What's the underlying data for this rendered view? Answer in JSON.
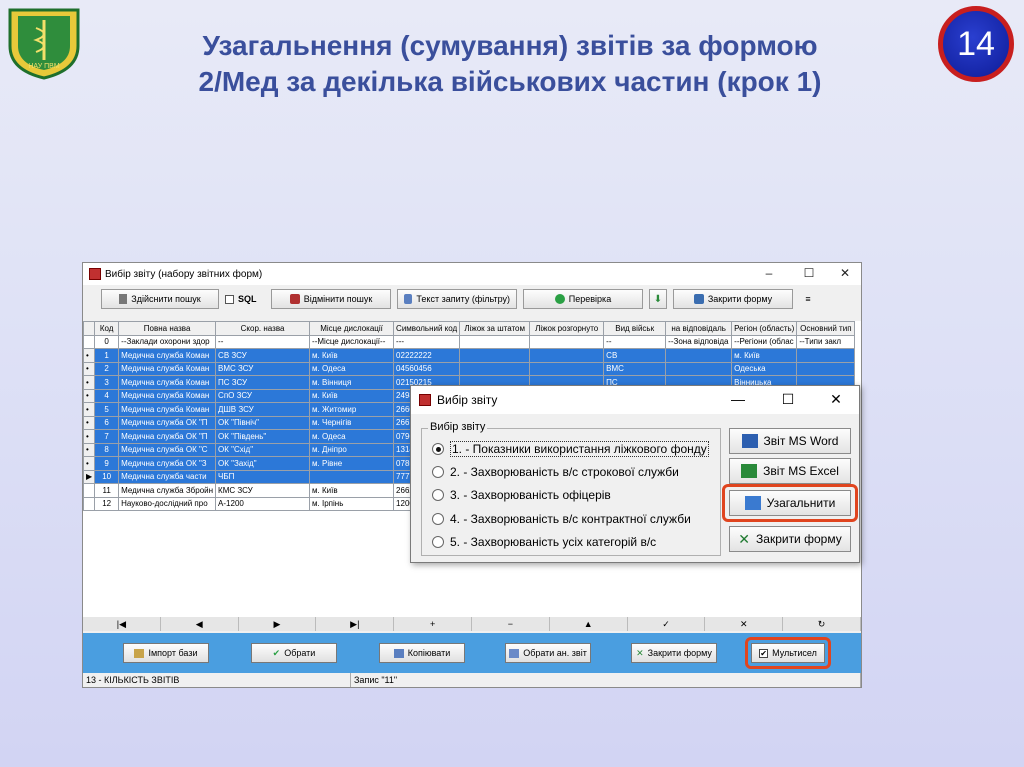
{
  "slide": {
    "title_line1": "Узагальнення (сумування) звітів за формою",
    "title_line2": "2/Мед за декілька військових частин (крок 1)",
    "number": "14",
    "emblem_text": "НАУ ПВМ"
  },
  "main_window": {
    "title": "Вибір звіту (набору звітних форм)",
    "controls": {
      "minimize": "–",
      "maximize": "☐",
      "close": "✕"
    },
    "toolbar": {
      "search": "Здійснити пошук",
      "sql": "SQL",
      "cancel_search": "Відмінити пошук",
      "query_text": "Текст запиту (фільтру)",
      "check": "Перевірка",
      "close_form": "Закрити форму"
    },
    "columns": [
      "",
      "Код",
      "Повна назва",
      "Скор. назва",
      "Місце дислокації",
      "Символьний код",
      "Ліжок за штатом",
      "Ліжок розгорнуто",
      "Вид військ",
      "на відповідаль",
      "Регіон (область)",
      "Основний тип"
    ],
    "rows": [
      {
        "ind": "",
        "code": "0",
        "full": "--Заклади охорони здор",
        "short": "--",
        "place": "--Місце дислокації--",
        "sym": "---",
        "b1": "",
        "b2": "",
        "kind": "--",
        "resp": "--Зона відповіда",
        "region": "--Регіони (облас",
        "type": "--Типи закл",
        "sel": false
      },
      {
        "ind": "•",
        "code": "1",
        "full": "Медична служба Коман",
        "short": "СВ ЗСУ",
        "place": "м. Київ",
        "sym": "02222222",
        "b1": "",
        "b2": "",
        "kind": "СВ",
        "resp": "",
        "region": "м. Київ",
        "type": "",
        "sel": true
      },
      {
        "ind": "•",
        "code": "2",
        "full": "Медична служба Коман",
        "short": "ВМС ЗСУ",
        "place": "м. Одеса",
        "sym": "04560456",
        "b1": "",
        "b2": "",
        "kind": "ВМС",
        "resp": "",
        "region": "Одеська",
        "type": "",
        "sel": true
      },
      {
        "ind": "•",
        "code": "3",
        "full": "Медична служба Коман",
        "short": "ПС ЗСУ",
        "place": "м. Вінниця",
        "sym": "02150215",
        "b1": "",
        "b2": "",
        "kind": "ПС",
        "resp": "",
        "region": "Вінницька",
        "type": "",
        "sel": true
      },
      {
        "ind": "•",
        "code": "4",
        "full": "Медична служба Коман",
        "short": "СпО ЗСУ",
        "place": "м. Київ",
        "sym": "2498",
        "b1": "",
        "b2": "",
        "kind": "",
        "resp": "",
        "region": "",
        "type": "",
        "sel": true
      },
      {
        "ind": "•",
        "code": "5",
        "full": "Медична служба Коман",
        "short": "ДШВ ЗСУ",
        "place": "м. Житомир",
        "sym": "2660",
        "b1": "",
        "b2": "",
        "kind": "",
        "resp": "",
        "region": "",
        "type": "",
        "sel": true
      },
      {
        "ind": "•",
        "code": "6",
        "full": "Медична служба ОК \"П",
        "short": "ОК \"Північ\"",
        "place": "м. Чернігів",
        "sym": "2661",
        "b1": "",
        "b2": "",
        "kind": "",
        "resp": "",
        "region": "",
        "type": "",
        "sel": true
      },
      {
        "ind": "•",
        "code": "7",
        "full": "Медична служба ОК \"П",
        "short": "ОК \"Південь\"",
        "place": "м. Одеса",
        "sym": "0796",
        "b1": "",
        "b2": "",
        "kind": "",
        "resp": "",
        "region": "",
        "type": "",
        "sel": true
      },
      {
        "ind": "•",
        "code": "8",
        "full": "Медична служба ОК \"С",
        "short": "ОК \"Схід\"",
        "place": "м. Дніпро",
        "sym": "1314",
        "b1": "",
        "b2": "",
        "kind": "",
        "resp": "",
        "region": "",
        "type": "",
        "sel": true
      },
      {
        "ind": "•",
        "code": "9",
        "full": "Медична служба ОК \"З",
        "short": "ОК \"Захід\"",
        "place": "м. Рівне",
        "sym": "0785",
        "b1": "",
        "b2": "",
        "kind": "",
        "resp": "",
        "region": "",
        "type": "",
        "sel": true
      },
      {
        "ind": "▶",
        "code": "10",
        "full": "Медична служба части",
        "short": "ЧБП",
        "place": "",
        "sym": "7777",
        "b1": "",
        "b2": "",
        "kind": "",
        "resp": "",
        "region": "",
        "type": "",
        "sel": true
      },
      {
        "ind": "",
        "code": "11",
        "full": "Медична служба Збройн",
        "short": "КМС ЗСУ",
        "place": "м. Київ",
        "sym": "2662",
        "b1": "",
        "b2": "",
        "kind": "",
        "resp": "",
        "region": "",
        "type": "",
        "sel": false
      },
      {
        "ind": "",
        "code": "12",
        "full": "Науково-дослідний про",
        "short": "А-1200",
        "place": "м. Ірпінь",
        "sym": "1200",
        "b1": "",
        "b2": "",
        "kind": "",
        "resp": "",
        "region": "",
        "type": "",
        "sel": false
      }
    ],
    "nav": [
      "|◀",
      "◀",
      "▶",
      "▶|",
      "+",
      "−",
      "▲",
      "✓",
      "✕",
      "↻"
    ],
    "bottom": {
      "import": "Імпорт бази",
      "choose": "Обрати",
      "copy": "Копіювати",
      "choose_an": "Обрати ан. звіт",
      "close_form": "Закрити форму",
      "multisel": "Мультисел"
    },
    "status": {
      "left": "13 - КІЛЬКІСТЬ ЗВІТІВ",
      "right": "Запис \"11\""
    }
  },
  "dialog": {
    "title": "Вибір звіту",
    "controls": {
      "minimize": "—",
      "maximize": "☐",
      "close": "✕"
    },
    "group_label": "Вибір звіту",
    "options": [
      {
        "label": "1. - Показники використання ліжкового фонду",
        "selected": true
      },
      {
        "label": "2. - Захворюваність в/с строкової служби",
        "selected": false
      },
      {
        "label": "3. - Захворюваність офіцерів",
        "selected": false
      },
      {
        "label": "4. - Захворюваність в/с контрактної служби",
        "selected": false
      },
      {
        "label": "5. - Захворюваність усіх категорій в/с",
        "selected": false
      }
    ],
    "buttons": {
      "word": "Звіт MS Word",
      "excel": "Звіт MS Excel",
      "generalize": "Узагальнити",
      "close": "Закрити форму"
    }
  },
  "colors": {
    "title": "#3a4f9c",
    "selection": "#2c78d8",
    "bottom_bar": "#4a9ee0",
    "highlight": "#e0451f"
  }
}
